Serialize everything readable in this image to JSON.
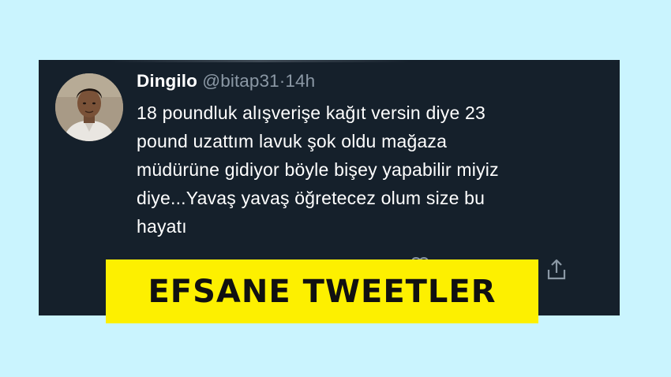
{
  "tweet": {
    "display_name": "Dingilo",
    "handle": "@bitap31",
    "separator": "·",
    "time": "14h",
    "text_lines": [
      "18 poundluk alışverişe kağıt versin diye 23",
      "pound uzattım lavuk şok oldu mağaza",
      "müdürüne gidiyor böyle bişey yapabilir miyiz",
      "diye...Yavaş yavaş öğretecez olum size bu",
      "hayatı"
    ]
  },
  "icons": {
    "avatar": "avatar-photo",
    "reply": "reply-icon",
    "like": "heart-icon",
    "share": "share-icon"
  },
  "banner": {
    "label": "EFSANE TWEETLER"
  },
  "colors": {
    "page_background": "#caf4fe",
    "card_background": "#15202b",
    "text_primary": "#ffffff",
    "text_secondary": "#8b98a5",
    "banner_background": "#fdf000",
    "banner_text": "#111111"
  }
}
